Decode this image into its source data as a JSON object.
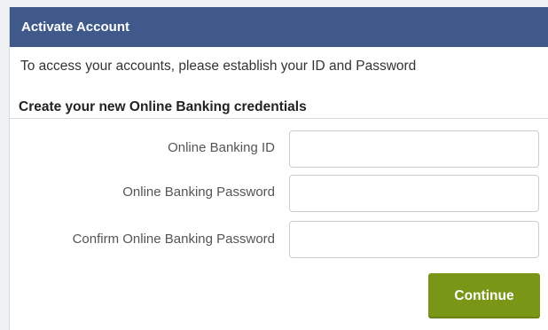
{
  "header": {
    "title": "Activate Account"
  },
  "intro_text": "To access your accounts, please establish your ID and Password",
  "section": {
    "title": "Create your new Online Banking credentials"
  },
  "form": {
    "fields": [
      {
        "label": "Online Banking ID",
        "value": "",
        "placeholder": ""
      },
      {
        "label": "Online Banking Password",
        "value": "",
        "placeholder": ""
      },
      {
        "label": "Confirm Online Banking Password",
        "value": "",
        "placeholder": ""
      }
    ],
    "submit_label": "Continue"
  },
  "colors": {
    "header_bg": "#3f5a8a",
    "button_bg": "#7a9617"
  }
}
